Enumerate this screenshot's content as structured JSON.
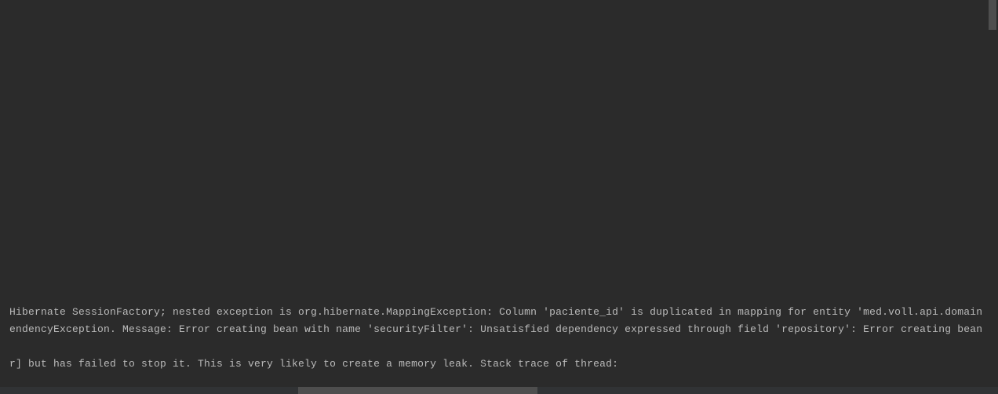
{
  "console": {
    "lines": [
      " Hibernate SessionFactory; nested exception is org.hibernate.MappingException: Column 'paciente_id' is duplicated in mapping for entity 'med.voll.api.domain",
      "endencyException. Message: Error creating bean with name 'securityFilter': Unsatisfied dependency expressed through field 'repository': Error creating bean",
      "",
      "r] but has failed to stop it. This is very likely to create a memory leak. Stack trace of thread:"
    ]
  }
}
